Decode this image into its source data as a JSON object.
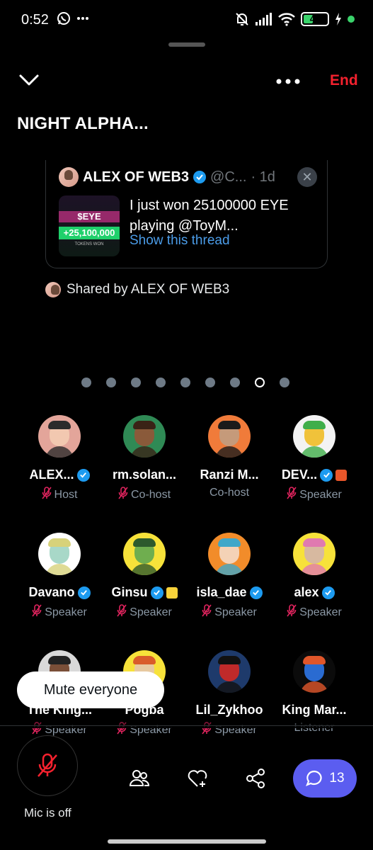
{
  "status_bar": {
    "time": "0:52",
    "battery_level": "40",
    "battery_level_fraction": 0.4
  },
  "header": {
    "end_label": "End",
    "title": "NIGHT ALPHA..."
  },
  "pinned_post": {
    "author_name": "ALEX OF WEB3",
    "author_handle": "@C...",
    "age": "· 1d",
    "text": "I just won 25100000 EYE playing @ToyM...",
    "thumbnail": {
      "token": "$EYE",
      "amount": "+25,100,000",
      "caption": "TOKENS WON"
    },
    "link": "Show this thread",
    "shared_by": "Shared by ALEX OF WEB3"
  },
  "pager": {
    "total": 9,
    "active_index": 7
  },
  "participants": [
    {
      "name": "ALEX...",
      "role": "Host",
      "verified": true,
      "muted": true,
      "extra_badge": null
    },
    {
      "name": "rm.solan...",
      "role": "Co-host",
      "verified": false,
      "muted": true,
      "extra_badge": null
    },
    {
      "name": "Ranzi M...",
      "role": "Co-host",
      "verified": false,
      "muted": false,
      "extra_badge": null
    },
    {
      "name": "DEV...",
      "role": "Speaker",
      "verified": true,
      "muted": true,
      "extra_badge": "orange"
    },
    {
      "name": "Davano",
      "role": "Speaker",
      "verified": true,
      "muted": true,
      "extra_badge": null
    },
    {
      "name": "Ginsu",
      "role": "Speaker",
      "verified": true,
      "muted": true,
      "extra_badge": "yellow"
    },
    {
      "name": "isla_dae",
      "role": "Speaker",
      "verified": true,
      "muted": true,
      "extra_badge": null
    },
    {
      "name": "alex",
      "role": "Speaker",
      "verified": true,
      "muted": true,
      "extra_badge": null
    },
    {
      "name": "The King...",
      "role": "Speaker",
      "verified": false,
      "muted": true,
      "extra_badge": null
    },
    {
      "name": "Pogba",
      "role": "Speaker",
      "verified": false,
      "muted": true,
      "extra_badge": null
    },
    {
      "name": "Lil_Zykhoo",
      "role": "Speaker",
      "verified": false,
      "muted": true,
      "extra_badge": null
    },
    {
      "name": "King Mar...",
      "role": "Listener",
      "verified": false,
      "muted": false,
      "extra_badge": null
    }
  ],
  "tooltip": {
    "label": "Mute everyone"
  },
  "bottom_bar": {
    "mic_label": "Mic is off",
    "comments_count": "13"
  },
  "colors": {
    "end": "#f4212e",
    "link": "#4b9ce8",
    "verified": "#1d9bf0",
    "mic_off": "#f4212e",
    "chat_button": "#5b5df0"
  },
  "icons": [
    "whatsapp-icon",
    "silent-icon",
    "signal-icon",
    "wifi-icon",
    "chevron-down-icon",
    "more-icon",
    "close-icon",
    "mic-off-icon",
    "people-icon",
    "heart-plus-icon",
    "share-icon",
    "chat-icon"
  ]
}
